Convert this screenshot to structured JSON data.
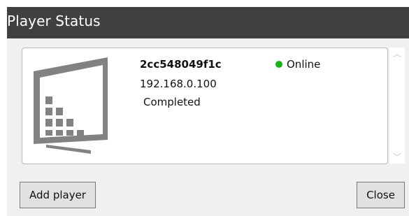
{
  "window": {
    "title": "Player Status"
  },
  "player": {
    "name": "2cc548049f1c",
    "ip": "192.168.0.100",
    "state": "Completed",
    "status": "Online",
    "status_color": "#18b31b",
    "icon": "monitor-icon"
  },
  "scrollbar": {
    "up_icon": "chevron-up-icon",
    "down_icon": "chevron-down-icon"
  },
  "buttons": {
    "add_player": "Add player",
    "close": "Close"
  }
}
